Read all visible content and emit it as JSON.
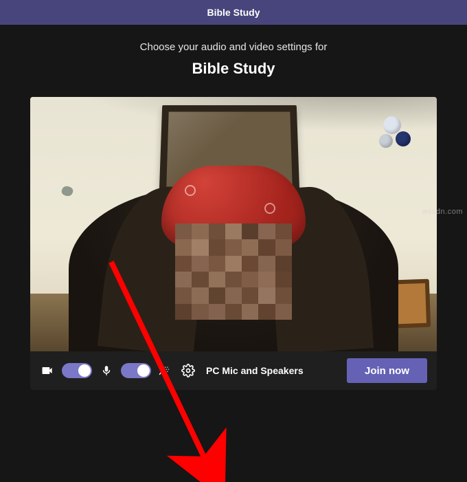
{
  "titlebar": {
    "title": "Bible Study"
  },
  "header": {
    "subheading": "Choose your audio and video settings for",
    "meeting_name": "Bible Study"
  },
  "controls": {
    "camera_toggle_on": true,
    "mic_toggle_on": true,
    "device_label": "PC Mic and Speakers",
    "join_label": "Join now"
  },
  "icons": {
    "camera": "camera-icon",
    "mic": "mic-icon",
    "background_fx": "background-effects-icon",
    "settings": "gear-icon"
  },
  "colors": {
    "accent": "#6562b5",
    "toggle_on": "#7b78c7",
    "titlebar_bg": "#47457c",
    "arrow": "#ff0000"
  },
  "watermark": "wssdn.com"
}
